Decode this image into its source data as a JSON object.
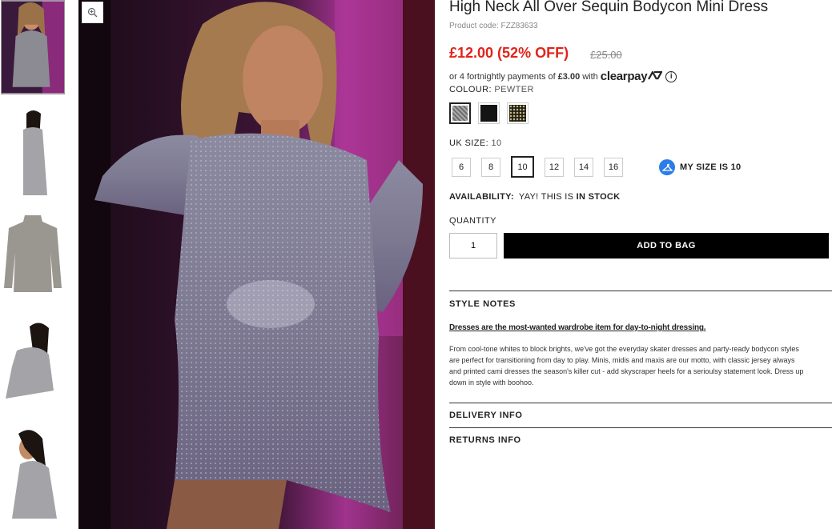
{
  "product": {
    "title": "High Neck All Over Sequin Bodycon Mini Dress",
    "code": "Product code: FZZ83633",
    "price": "£12.00 (52% OFF)",
    "was_price": "£25.00",
    "clearpay_text": "or 4 fortnightly payments of",
    "clearpay_amount": "£3.00",
    "clearpay_with": "with",
    "clearpay_logo": "clearpay",
    "info_glyph": "i"
  },
  "colour": {
    "label": "COLOUR:",
    "value": "PEWTER",
    "swatches": [
      {
        "name": "pewter",
        "color": "#8e8e8e",
        "selected": true
      },
      {
        "name": "black",
        "color": "#141414",
        "selected": false
      },
      {
        "name": "gold",
        "color": "#2a2a1e",
        "selected": false
      }
    ]
  },
  "size": {
    "label": "UK SIZE:",
    "value": "10",
    "options": [
      "6",
      "8",
      "10",
      "12",
      "14",
      "16"
    ],
    "selected": "10",
    "my_size": "MY SIZE IS 10"
  },
  "availability": {
    "label": "AVAILABILITY:",
    "text": "YAY! THIS IS",
    "status": "IN STOCK"
  },
  "quantity": {
    "label": "QUANTITY",
    "value": "1"
  },
  "add_to_bag": "ADD TO BAG",
  "style_notes": {
    "title": "STYLE NOTES",
    "intro": "Dresses are the most-wanted wardrobe item for day-to-night dressing.",
    "lines": [
      "From cool-tone whites to block brights, we've got the everyday skater dresses and party-ready bodycon styles",
      "are perfect for transitioning from day to play. Minis, midis and maxis are our motto, with classic jersey always",
      "and printed cami dresses the season's killer cut - add skyscraper heels for a serioulsy statement look. Dress up",
      "down in style with boohoo."
    ]
  },
  "delivery_info": "DELIVERY INFO",
  "returns_info": "RETURNS INFO",
  "colors": {
    "price_red": "#e2231a",
    "button_black": "#000000",
    "hanger_blue": "#2b7de9"
  }
}
